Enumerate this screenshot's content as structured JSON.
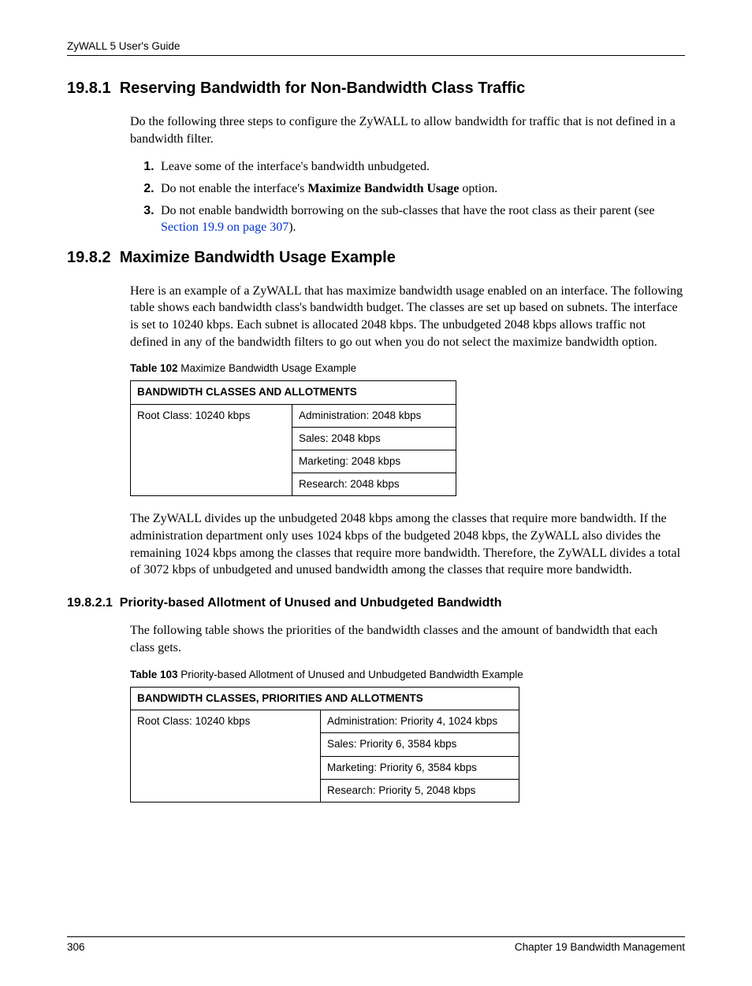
{
  "header": {
    "guide": "ZyWALL 5 User's Guide"
  },
  "s1": {
    "num": "19.8.1",
    "title": "Reserving Bandwidth for Non-Bandwidth Class Traffic",
    "intro": "Do the following three steps to configure the ZyWALL to allow bandwidth for traffic that is not defined in a bandwidth filter.",
    "step1": "Leave some of the interface's bandwidth unbudgeted.",
    "step2a": "Do not enable the interface's ",
    "step2b": "Maximize Bandwidth Usage",
    "step2c": " option.",
    "step3a": "Do not enable bandwidth borrowing on the sub-classes that have the root class as their parent (see ",
    "step3link": "Section 19.9 on page 307",
    "step3b": ")."
  },
  "s2": {
    "num": "19.8.2",
    "title": "Maximize Bandwidth Usage Example",
    "p1": "Here is an example of a ZyWALL that has maximize bandwidth usage enabled on an interface. The following table shows each bandwidth class's bandwidth budget. The classes are set up based on subnets. The interface is set to 10240 kbps. Each subnet is allocated 2048 kbps. The unbudgeted 2048 kbps allows traffic not defined in any of the bandwidth filters to go out when you do not select the maximize bandwidth option.",
    "t102cap_b": "Table 102",
    "t102cap": "   Maximize Bandwidth Usage Example",
    "t102": {
      "header": "BANDWIDTH CLASSES AND ALLOTMENTS",
      "root": "Root Class: 10240 kbps",
      "r1": "Administration: 2048 kbps",
      "r2": "Sales: 2048 kbps",
      "r3": "Marketing: 2048 kbps",
      "r4": "Research: 2048 kbps"
    },
    "p2": "The ZyWALL divides up the unbudgeted 2048 kbps among the classes that require more bandwidth. If the administration department only uses 1024 kbps of the budgeted 2048 kbps, the ZyWALL also divides the remaining 1024 kbps among the classes that require more bandwidth. Therefore, the ZyWALL divides a total of 3072 kbps of unbudgeted and unused bandwidth among the classes that require more bandwidth."
  },
  "s3": {
    "num": "19.8.2.1",
    "title": "Priority-based Allotment of Unused and Unbudgeted Bandwidth",
    "p1": "The following table shows the priorities of the bandwidth classes and the amount of bandwidth that each class gets.",
    "t103cap_b": "Table 103",
    "t103cap": "   Priority-based Allotment of Unused and Unbudgeted Bandwidth Example",
    "t103": {
      "header": "BANDWIDTH CLASSES, PRIORITIES AND ALLOTMENTS",
      "root": "Root Class: 10240 kbps",
      "r1": "Administration: Priority 4, 1024 kbps",
      "r2": "Sales: Priority 6, 3584 kbps",
      "r3": "Marketing: Priority 6, 3584 kbps",
      "r4": "Research: Priority 5, 2048 kbps"
    }
  },
  "footer": {
    "page": "306",
    "chapter": "Chapter 19 Bandwidth Management"
  }
}
